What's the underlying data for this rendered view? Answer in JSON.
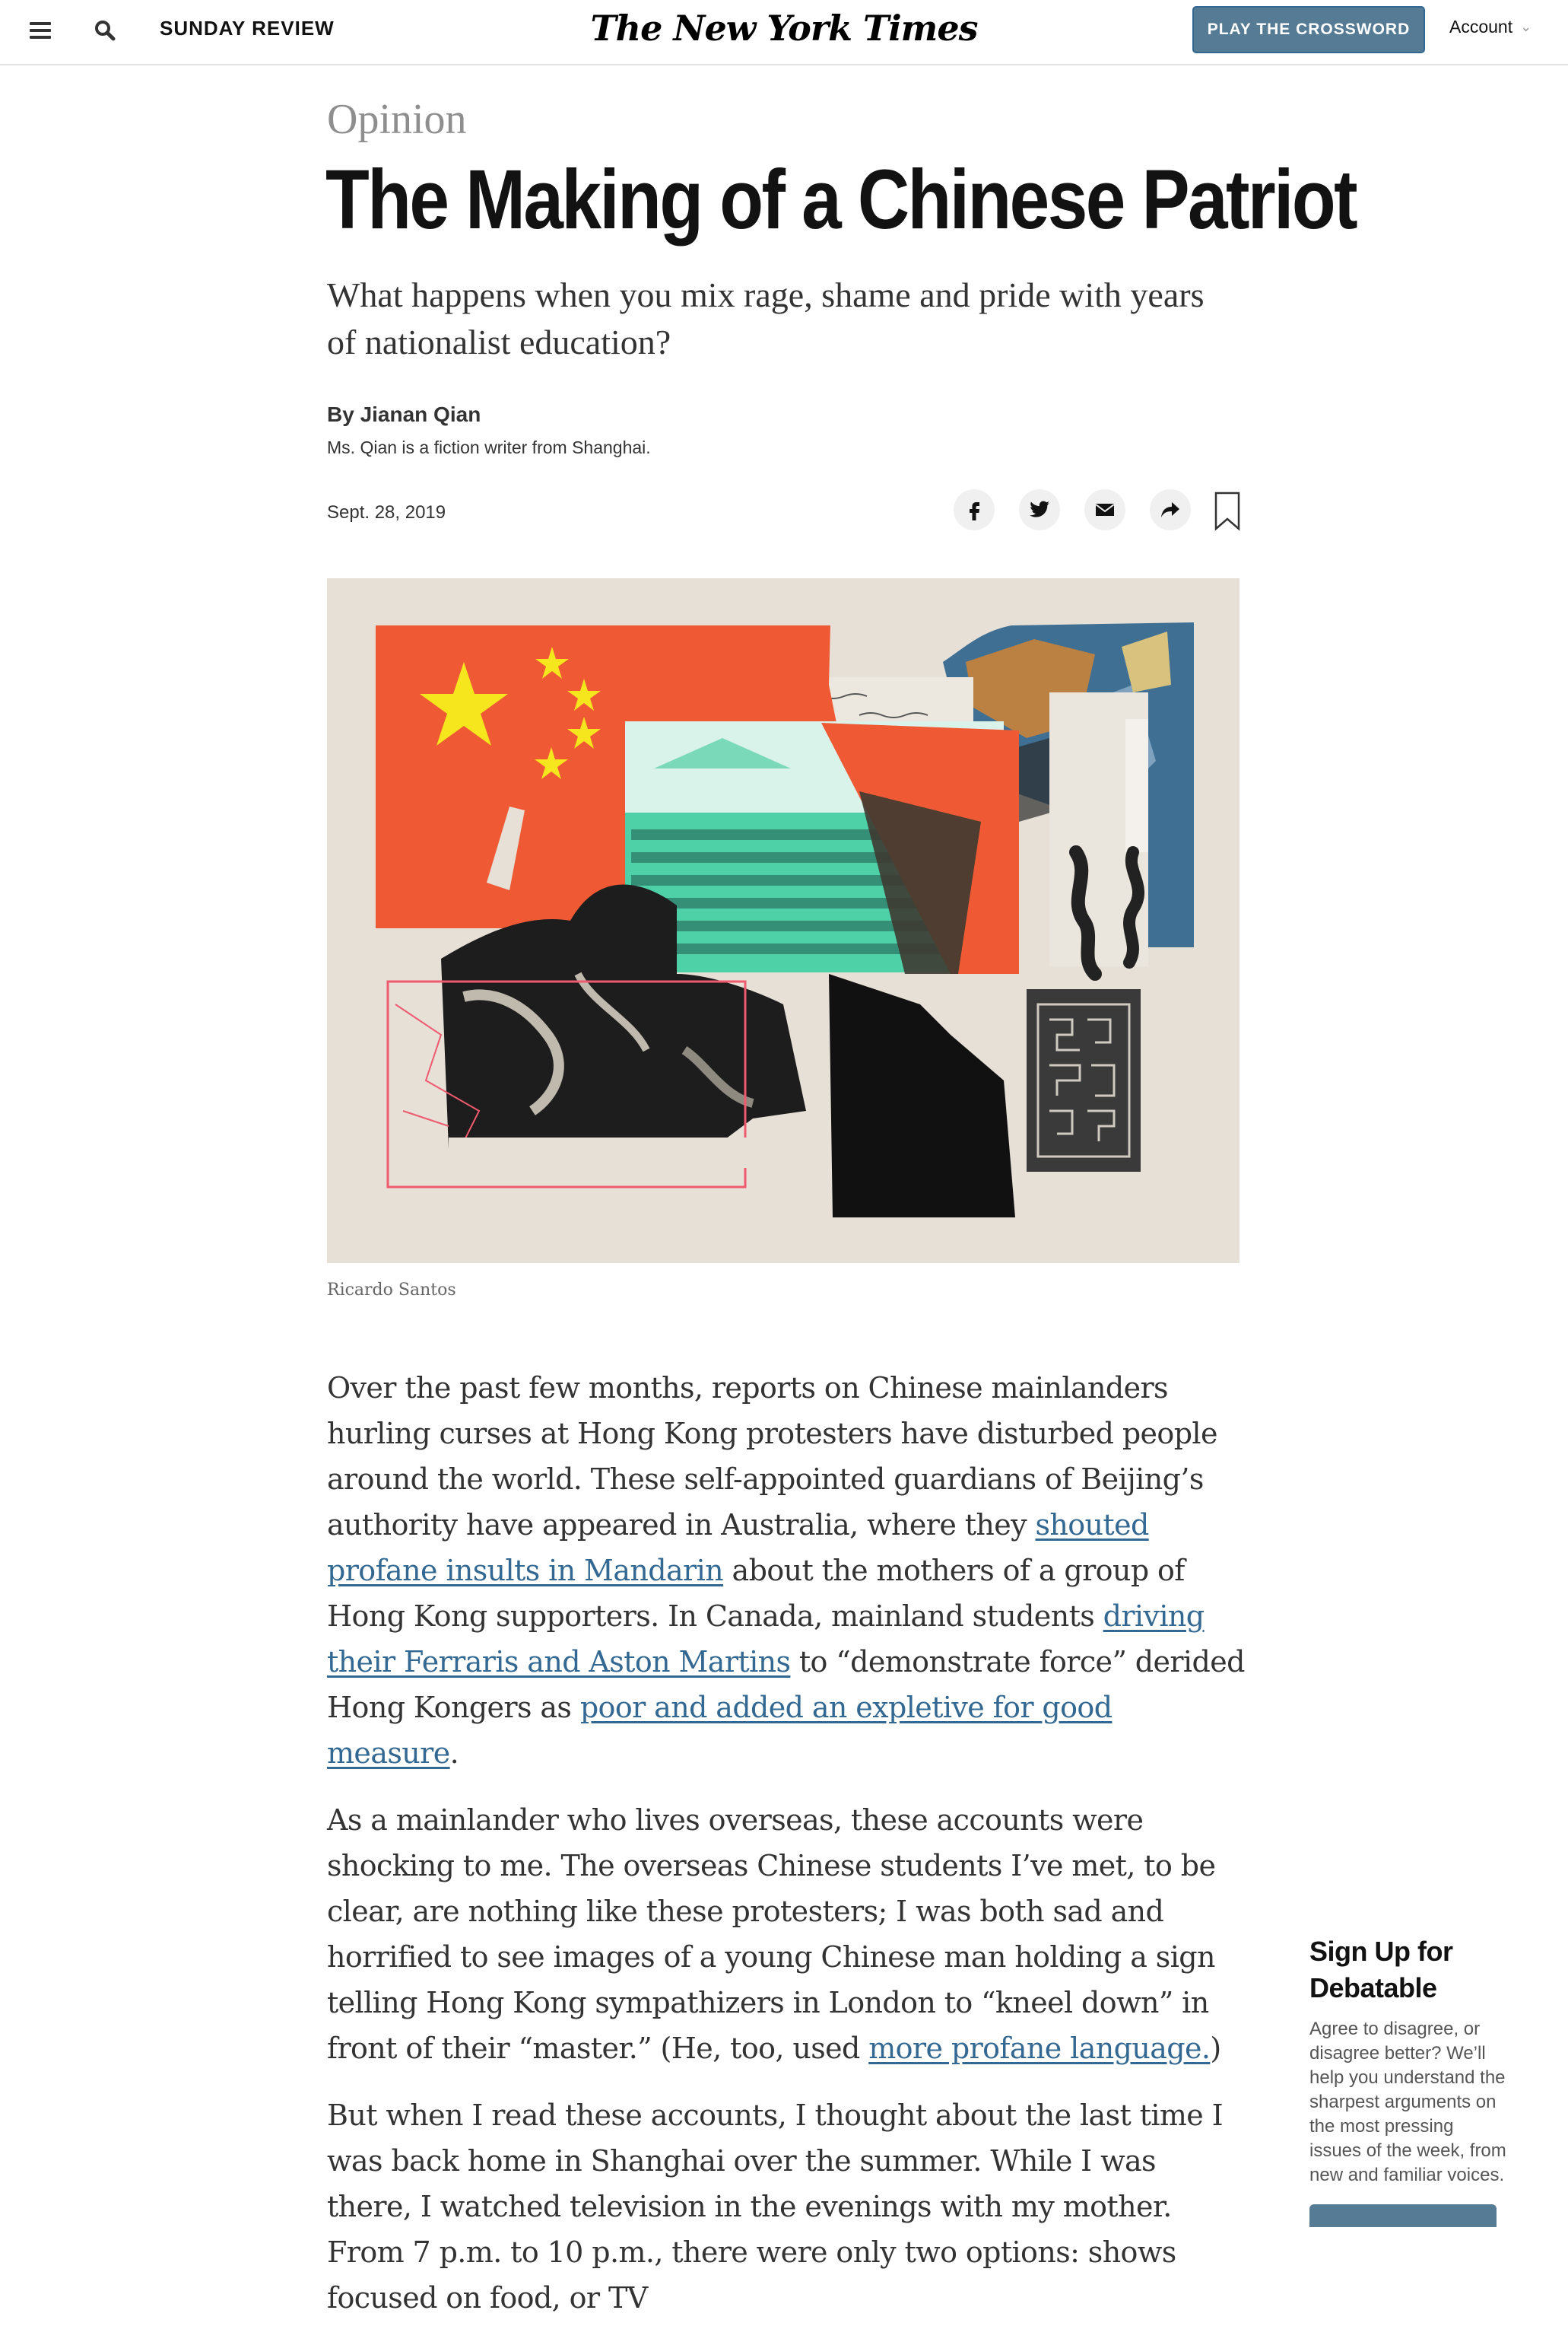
{
  "header": {
    "section": "SUNDAY REVIEW",
    "logo": "The New York Times",
    "crossword_button": "PLAY THE CROSSWORD",
    "account_label": "Account"
  },
  "article": {
    "kicker": "Opinion",
    "headline": "The Making of a Chinese Patriot",
    "summary": "What happens when you mix rage, shame and pride with years of nationalist education?",
    "byline_prefix": "By ",
    "author": "Jianan Qian",
    "author_bio": "Ms. Qian is a fiction writer from Shanghai.",
    "date": "Sept. 28, 2019",
    "image_credit": "Ricardo Santos",
    "p1": {
      "t1": "Over the past few months, reports on Chinese mainlanders hurling curses at Hong Kong protesters have disturbed people around the world. These self-appointed guardians of Beijing’s authority have appeared in Australia, where they ",
      "l1": "shouted profane insults in Mandarin",
      "t2": " about the mothers of a group of Hong Kong supporters. In Canada, mainland students ",
      "l2": "driving their Ferraris and Aston Martins",
      "t3": " to “demonstrate force” derided Hong Kongers as ",
      "l3": "poor and added an expletive for good measure",
      "t4": "."
    },
    "p2": {
      "t1": "As a mainlander who lives overseas, these accounts were shocking to me. The overseas Chinese students I’ve met, to be clear, are nothing like these protesters; I was both sad and horrified to see images of a young Chinese man holding a sign telling Hong Kong sympathizers in London to “kneel down” in front of their “master.” (He, too, used ",
      "l1": "more profane language.",
      "t2": ")"
    },
    "p3": "But when I read these accounts, I thought about the last time I was back home in Shanghai over the summer. While I was there, I watched television in the evenings with my mother. From 7 p.m. to 10 p.m., there were only two options: shows focused on food, or TV"
  },
  "promo": {
    "title": "Sign Up for Debatable",
    "description": "Agree to disagree, or disagree better? We’ll help you understand the sharpest arguments on the most pressing issues of the week, from new and familiar voices."
  },
  "colors": {
    "link": "#326891",
    "button": "#567b95",
    "flag_red": "#ef5a35",
    "star_yellow": "#f6e61e",
    "mint": "#4fd1a8",
    "paper": "#e6e0d7"
  },
  "icons": [
    "menu-icon",
    "search-icon",
    "chevron-down-icon",
    "facebook-icon",
    "twitter-icon",
    "email-icon",
    "share-icon",
    "bookmark-icon"
  ]
}
